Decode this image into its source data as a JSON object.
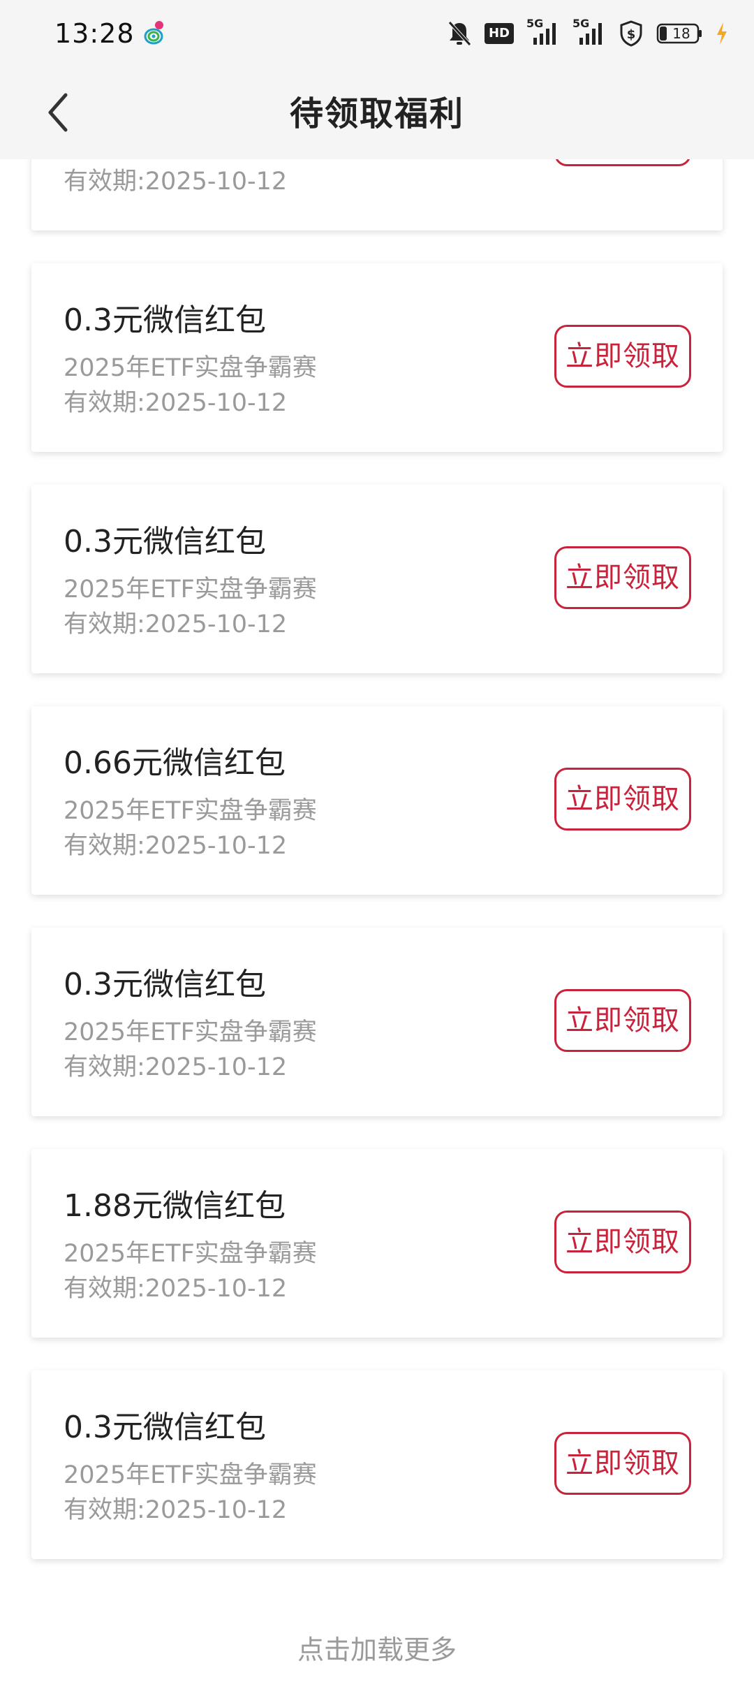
{
  "status_bar": {
    "time": "13:28",
    "network_1": "5G",
    "network_2": "5G",
    "hd_label": "HD",
    "battery_level": "18",
    "icons": [
      "carrier-icon",
      "mute-icon",
      "hd-icon",
      "signal-icon",
      "signal-icon",
      "shield-dollar-icon",
      "battery-icon",
      "charging-icon"
    ]
  },
  "header": {
    "title": "待领取福利",
    "back_icon": "chevron-left-icon"
  },
  "claim_label": "立即领取",
  "rewards": [
    {
      "title": "",
      "source": "",
      "validity": "有效期:2025-10-12"
    },
    {
      "title": "0.3元微信红包",
      "source": "2025年ETF实盘争霸赛",
      "validity": "有效期:2025-10-12"
    },
    {
      "title": "0.3元微信红包",
      "source": "2025年ETF实盘争霸赛",
      "validity": "有效期:2025-10-12"
    },
    {
      "title": "0.66元微信红包",
      "source": "2025年ETF实盘争霸赛",
      "validity": "有效期:2025-10-12"
    },
    {
      "title": "0.3元微信红包",
      "source": "2025年ETF实盘争霸赛",
      "validity": "有效期:2025-10-12"
    },
    {
      "title": "1.88元微信红包",
      "source": "2025年ETF实盘争霸赛",
      "validity": "有效期:2025-10-12"
    },
    {
      "title": "0.3元微信红包",
      "source": "2025年ETF实盘争霸赛",
      "validity": "有效期:2025-10-12"
    }
  ],
  "load_more": "点击加载更多",
  "colors": {
    "accent": "#c8233b",
    "bar_background": "#f5f5f5",
    "secondary_text": "#9a9a9a"
  }
}
